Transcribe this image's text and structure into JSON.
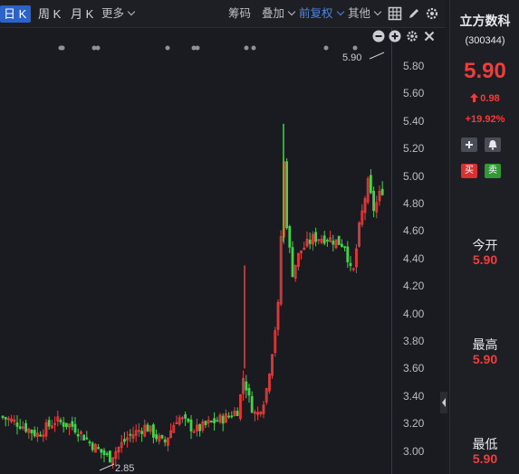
{
  "toolbar": {
    "tabs": [
      {
        "label": "日 K",
        "active": true
      },
      {
        "label": "周 K",
        "active": false
      },
      {
        "label": "月 K",
        "active": false
      }
    ],
    "more_label": "更多",
    "chips_label": "筹码",
    "overlay_label": "叠加",
    "adjust_label": "前复权",
    "other_label": "其他",
    "icons": [
      "grid-icon",
      "draw-icon",
      "settings-icon"
    ]
  },
  "chart": {
    "y_ticks": [
      "5.80",
      "5.60",
      "5.40",
      "5.20",
      "5.00",
      "4.80",
      "4.60",
      "4.40",
      "4.20",
      "4.00",
      "3.80",
      "3.60",
      "3.40",
      "3.20",
      "3.00"
    ],
    "ylim": [
      2.9,
      5.9
    ],
    "high_marker": "5.90",
    "low_marker": "2.85",
    "colors": {
      "up": "#f23c3c",
      "down": "#47d14a",
      "accent": "#4b86e6"
    },
    "controls": [
      "minus-icon",
      "plus-icon",
      "settings-icon",
      "close-icon"
    ]
  },
  "stock": {
    "name": "立方数科",
    "code": "(300344)",
    "price": "5.90",
    "change": "0.98",
    "change_pct": "+19.92%",
    "buy_label": "买",
    "sell_label": "卖",
    "stats": [
      {
        "label": "今开",
        "value": "5.90"
      },
      {
        "label": "最高",
        "value": "5.90"
      },
      {
        "label": "最低",
        "value": "5.90"
      }
    ]
  }
}
